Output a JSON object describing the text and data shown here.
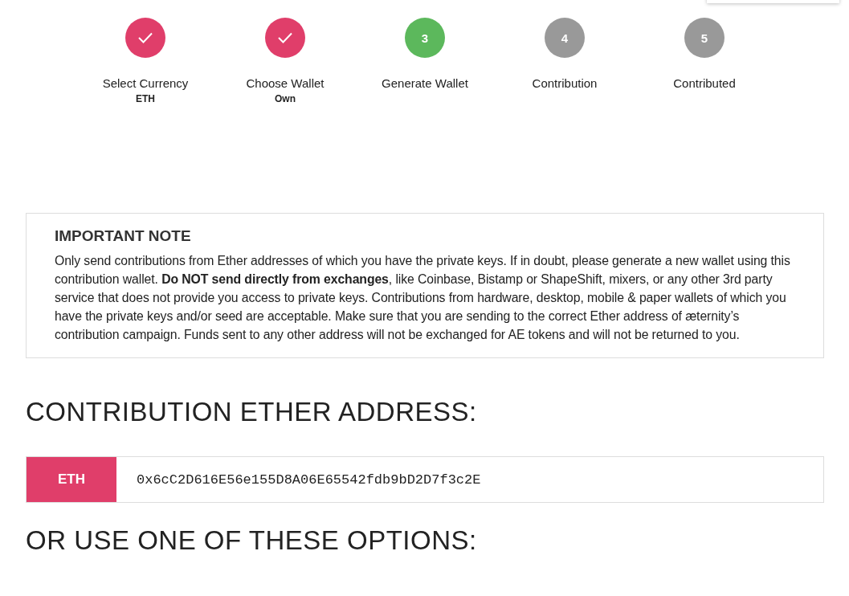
{
  "steps": [
    {
      "completed": true,
      "current": false,
      "label": "Select Currency",
      "value": "ETH"
    },
    {
      "completed": true,
      "current": false,
      "label": "Choose Wallet",
      "value": "Own"
    },
    {
      "completed": false,
      "current": true,
      "number": "3",
      "label": "Generate Wallet"
    },
    {
      "completed": false,
      "current": false,
      "number": "4",
      "label": "Contribution"
    },
    {
      "completed": false,
      "current": false,
      "number": "5",
      "label": "Contributed"
    }
  ],
  "note": {
    "title": "IMPORTANT NOTE",
    "text": "Only send contributions from Ether addresses of which you have the private keys. If in doubt, please generate a new wallet using this contribution wallet. **Do NOT send directly from exchanges**, like Coinbase, Bistamp or ShapeShift, mixers, or any other 3rd party service that does not provide you access to private keys. Contributions from hardware, desktop, mobile & paper wallets of which you have the private keys and/or seed are acceptable. Make sure that you are sending to the correct Ether address of æternity’s contribution campaign. Funds sent to any other address will not be exchanged for AE tokens and will not be returned to you."
  },
  "address_heading": "CONTRIBUTION ETHER ADDRESS:",
  "address": {
    "currency": "ETH",
    "value": "0x6cC2D616E56e155D8A06E65542fdb9bD2D7f3c2E"
  },
  "options_heading": "OR USE ONE OF THESE OPTIONS:"
}
